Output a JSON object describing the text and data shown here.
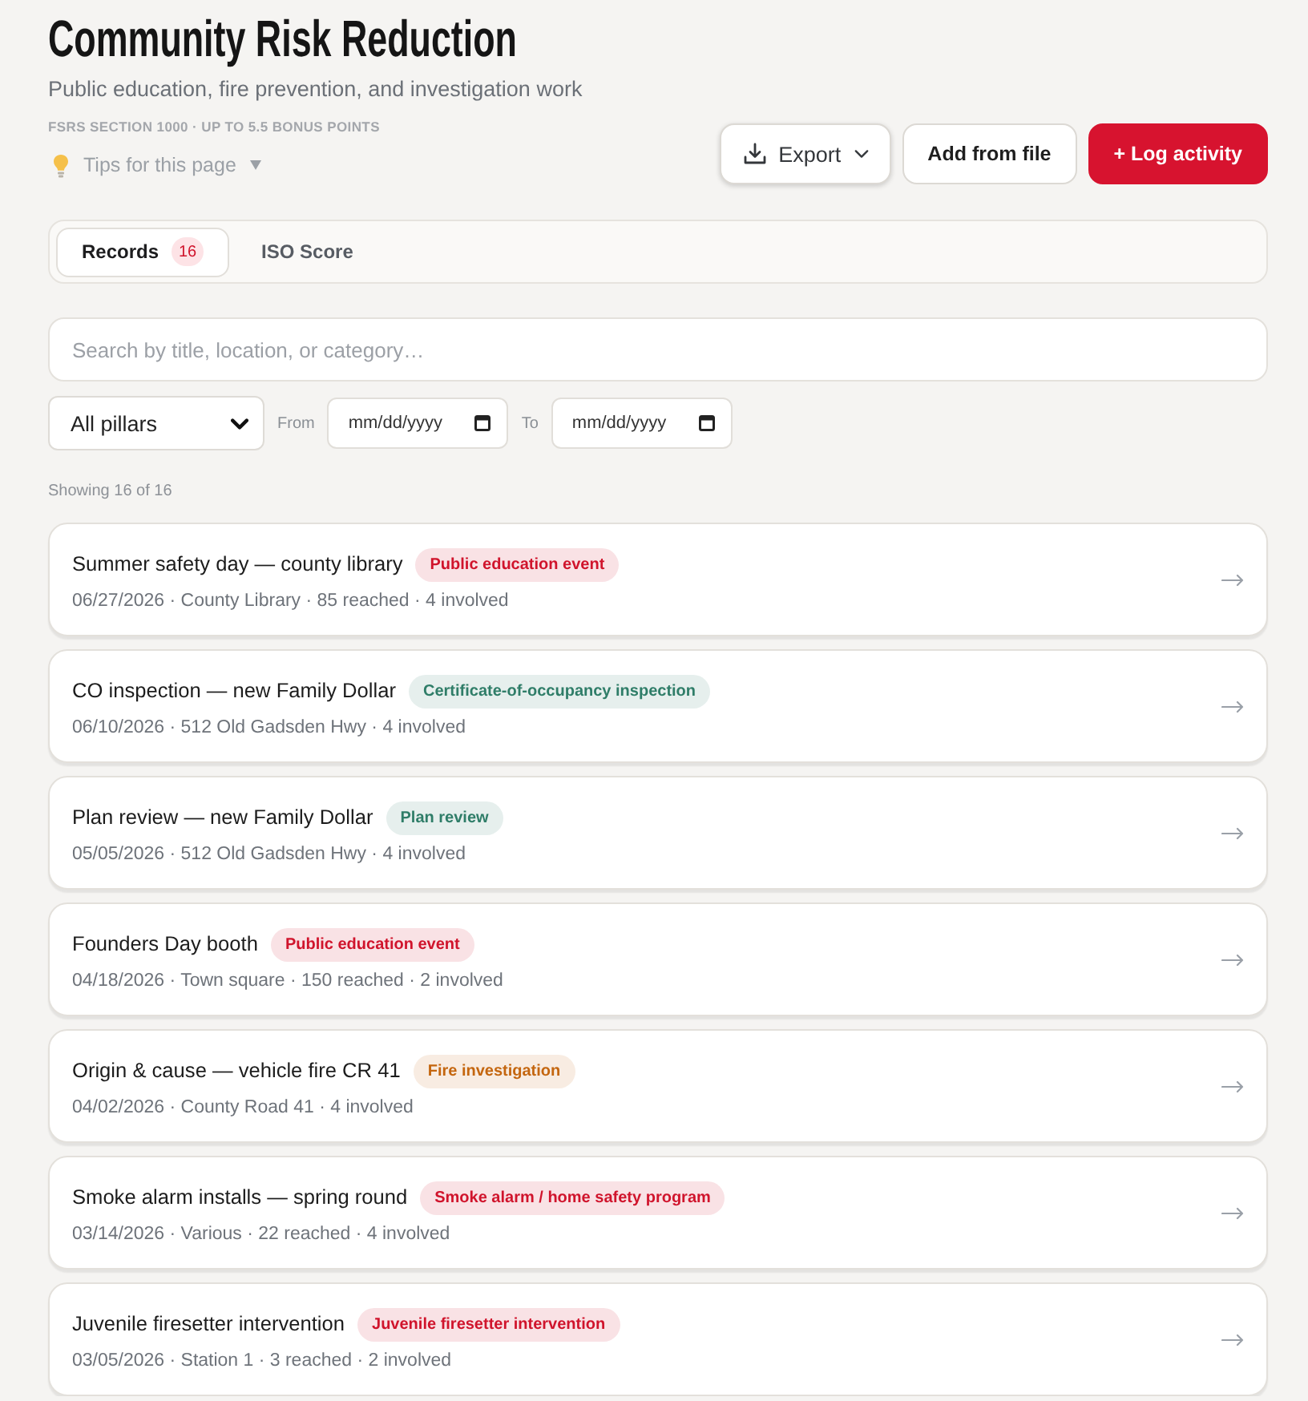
{
  "header": {
    "title": "Community Risk Reduction",
    "subtitle": "Public education, fire prevention, and investigation work",
    "kicker": "FSRS SECTION 1000 · UP TO 5.5 BONUS POINTS",
    "tips": {
      "label": "Tips for this page",
      "expanded": false
    }
  },
  "actions": [
    {
      "kind": "menu",
      "label": "Export"
    },
    {
      "kind": "secondary",
      "label": "Add from file"
    },
    {
      "kind": "primary",
      "label": "+ Log activity"
    }
  ],
  "tabs": [
    {
      "label": "Records",
      "count": "16",
      "selected": true
    },
    {
      "label": "ISO Score",
      "selected": false
    }
  ],
  "search": {
    "placeholder": "Search by title, location, or category…"
  },
  "filters": {
    "pillar": {
      "value": "All pillars"
    },
    "from": {
      "label": "From",
      "placeholder": "mm/dd/yyyy"
    },
    "to": {
      "label": "To",
      "placeholder": "mm/dd/yyyy"
    }
  },
  "result_count": "Showing 16 of 16",
  "records": [
    {
      "title": "Summer safety day — county library",
      "category": "Public education event",
      "color": "#d0142c",
      "meta": "06/27/2026 · County Library · 85 reached · 4 involved"
    },
    {
      "title": "CO inspection — new Family Dollar",
      "category": "Certificate-of-occupancy inspection",
      "color": "#2f7d68",
      "meta": "06/10/2026 · 512 Old Gadsden Hwy · 4 involved"
    },
    {
      "title": "Plan review — new Family Dollar",
      "category": "Plan review",
      "color": "#2f7d68",
      "meta": "05/05/2026 · 512 Old Gadsden Hwy · 4 involved"
    },
    {
      "title": "Founders Day booth",
      "category": "Public education event",
      "color": "#d0142c",
      "meta": "04/18/2026 · Town square · 150 reached · 2 involved"
    },
    {
      "title": "Origin & cause — vehicle fire CR 41",
      "category": "Fire investigation",
      "color": "#c4660f",
      "meta": "04/02/2026 · County Road 41 · 4 involved"
    },
    {
      "title": "Smoke alarm installs — spring round",
      "category": "Smoke alarm / home safety program",
      "color": "#d0142c",
      "meta": "03/14/2026 · Various · 22 reached · 4 involved"
    },
    {
      "title": "Juvenile firesetter intervention",
      "category": "Juvenile firesetter intervention",
      "color": "#d0142c",
      "meta": "03/05/2026 · Station 1 · 3 reached · 2 involved"
    }
  ]
}
